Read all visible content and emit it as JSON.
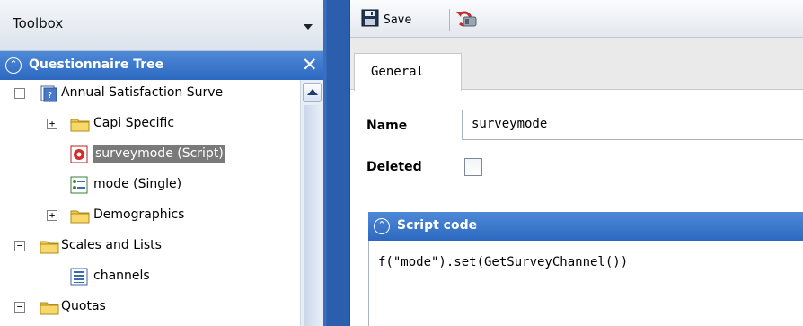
{
  "toolbox": {
    "title": "Toolbox"
  },
  "tree_panel": {
    "title": "Questionnaire Tree",
    "collapse_glyph": "⌃",
    "close_glyph": "✕",
    "items": [
      {
        "label": "Annual Satisfaction Surve",
        "icon": "survey-icon",
        "toggle": "−",
        "selected": false
      },
      {
        "label": "Capi Specific",
        "icon": "folder-icon",
        "toggle": "+",
        "selected": false
      },
      {
        "label": "surveymode (Script)",
        "icon": "script-icon",
        "toggle": "",
        "selected": true
      },
      {
        "label": "mode (Single)",
        "icon": "single-question-icon",
        "toggle": "",
        "selected": false
      },
      {
        "label": "Demographics",
        "icon": "folder-icon",
        "toggle": "+",
        "selected": false
      },
      {
        "label": "Scales and Lists",
        "icon": "folder-icon",
        "toggle": "−",
        "selected": false
      },
      {
        "label": "channels",
        "icon": "list-icon",
        "toggle": "",
        "selected": false
      },
      {
        "label": "Quotas",
        "icon": "folder-icon",
        "toggle": "−",
        "selected": false
      }
    ]
  },
  "toolbar": {
    "save_label": "Save"
  },
  "tabs": [
    {
      "label": "General",
      "active": true
    }
  ],
  "form": {
    "name_label": "Name",
    "name_value": "surveymode",
    "deleted_label": "Deleted",
    "deleted_checked": false
  },
  "script_panel": {
    "title": "Script code",
    "collapse_glyph": "⌃",
    "code": "f(\"mode\").set(GetSurveyChannel())"
  },
  "colors": {
    "panel_header": "#2c68bf",
    "splitter": "#2b5fae",
    "selection": "#7a7a7a",
    "folder": "#f1c94a"
  }
}
